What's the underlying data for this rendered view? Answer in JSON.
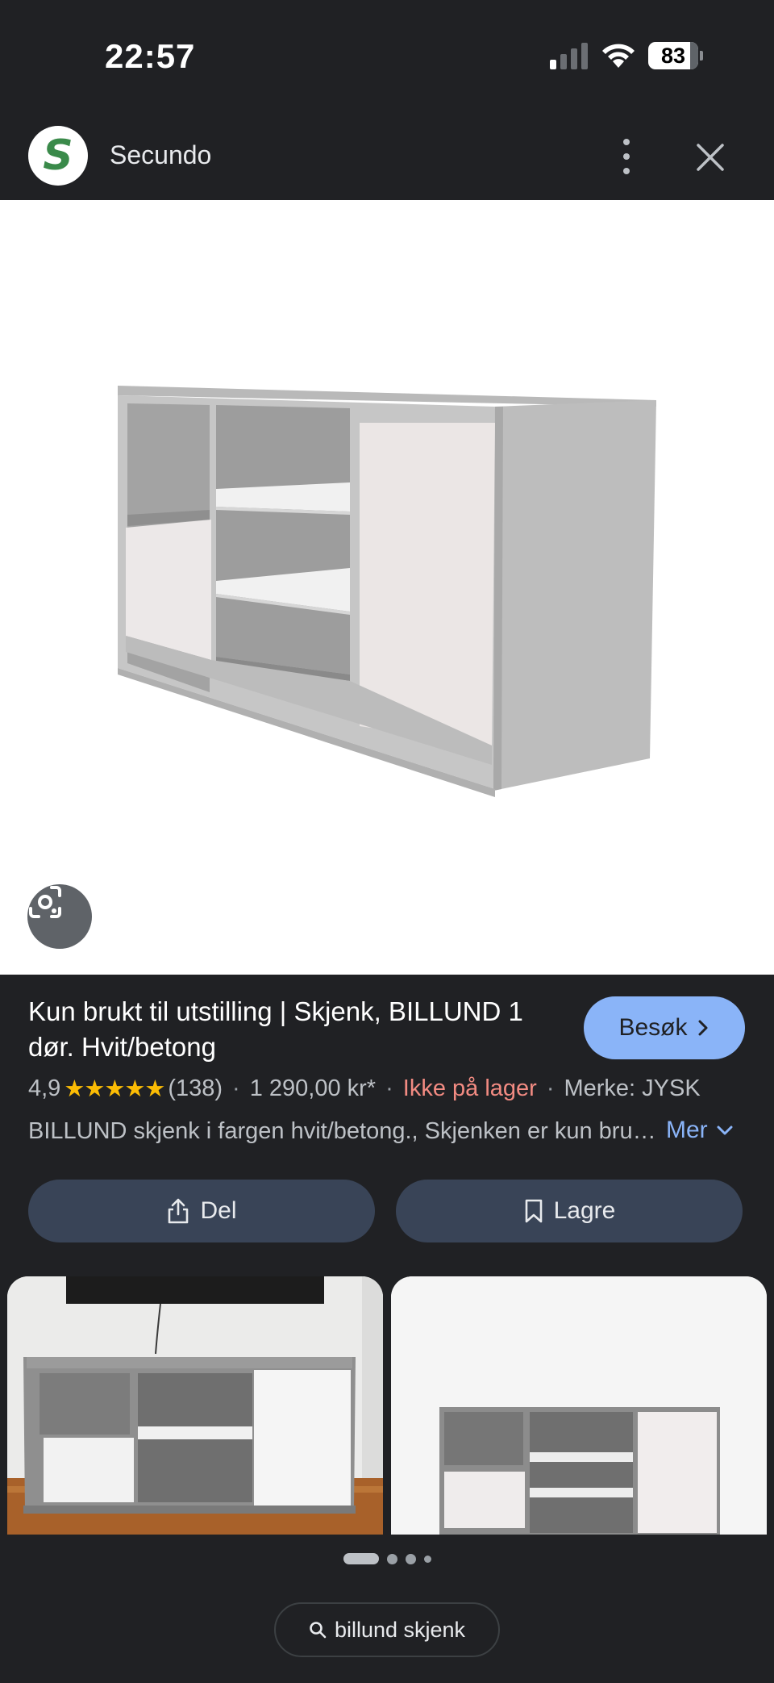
{
  "status_bar": {
    "time": "22:57",
    "battery": "83"
  },
  "header": {
    "site_name": "Secundo",
    "logo_letter": "S"
  },
  "product": {
    "title": "Kun brukt til utstilling | Skjenk, BILLUND 1 dør. Hvit/betong",
    "visit_label": "Besøk",
    "rating": "4,9",
    "stars": "★★★★★",
    "review_count": "(138)",
    "price": "1 290,00 kr*",
    "stock_status": "Ikke på lager",
    "brand": "Merke: JYSK",
    "description": "BILLUND skjenk i fargen hvit/betong., Skjenken er kun brukt til utstilling",
    "more_label": "Mer"
  },
  "actions": {
    "share_label": "Del",
    "save_label": "Lagre"
  },
  "search_chip": {
    "query": "billund skjenk"
  },
  "colors": {
    "background": "#202124",
    "accent": "#8ab4f8",
    "button": "#394457",
    "out_of_stock": "#f28b82",
    "star": "#fbbc04"
  },
  "icons": [
    "signal-icon",
    "wifi-icon",
    "battery-icon",
    "more-vert-icon",
    "close-icon",
    "lens-icon",
    "chevron-right-icon",
    "chevron-down-icon",
    "share-icon",
    "bookmark-icon",
    "search-icon"
  ]
}
